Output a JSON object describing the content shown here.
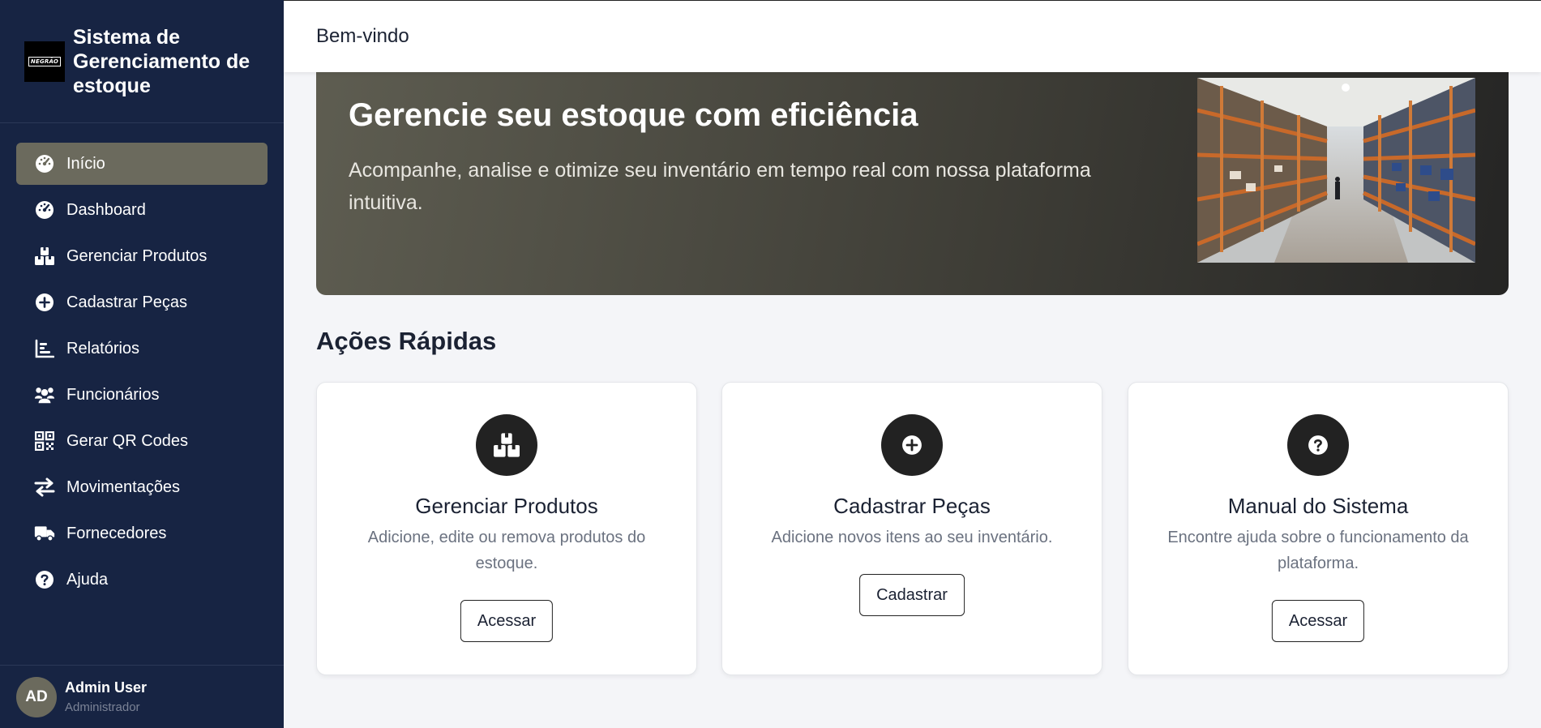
{
  "sidebar": {
    "brand": {
      "logo_text": "NEGRÃO",
      "title": "Sistema de Gerenciamento de estoque"
    },
    "items": [
      {
        "label": "Início",
        "icon": "gauge-icon",
        "active": true
      },
      {
        "label": "Dashboard",
        "icon": "gauge-icon",
        "active": false
      },
      {
        "label": "Gerenciar Produtos",
        "icon": "boxes-icon",
        "active": false
      },
      {
        "label": "Cadastrar Peças",
        "icon": "plus-circle-icon",
        "active": false
      },
      {
        "label": "Relatórios",
        "icon": "bar-chart-icon",
        "active": false
      },
      {
        "label": "Funcionários",
        "icon": "users-icon",
        "active": false
      },
      {
        "label": "Gerar QR Codes",
        "icon": "qrcode-icon",
        "active": false
      },
      {
        "label": "Movimentações",
        "icon": "exchange-icon",
        "active": false
      },
      {
        "label": "Fornecedores",
        "icon": "truck-icon",
        "active": false
      },
      {
        "label": "Ajuda",
        "icon": "question-circle-icon",
        "active": false
      }
    ],
    "user": {
      "initials": "AD",
      "name": "Admin User",
      "role": "Administrador"
    }
  },
  "header": {
    "title": "Bem-vindo"
  },
  "hero": {
    "title": "Gerencie seu estoque com eficiência",
    "text": "Acompanhe, analise e otimize seu inventário em tempo real com nossa plataforma intuitiva."
  },
  "quick_actions": {
    "title": "Ações Rápidas",
    "cards": [
      {
        "icon": "boxes-icon",
        "title": "Gerenciar Produtos",
        "description": "Adicione, edite ou remova produtos do estoque.",
        "button": "Acessar"
      },
      {
        "icon": "plus-circle-icon",
        "title": "Cadastrar Peças",
        "description": "Adicione novos itens ao seu inventário.",
        "button": "Cadastrar"
      },
      {
        "icon": "question-circle-icon",
        "title": "Manual do Sistema",
        "description": "Encontre ajuda sobre o funcionamento da plataforma.",
        "button": "Acessar"
      }
    ]
  },
  "colors": {
    "sidebar_bg": "#172443",
    "accent": "#6b6a5d",
    "icon_circle": "#222222",
    "page_bg": "#f4f5f8"
  }
}
